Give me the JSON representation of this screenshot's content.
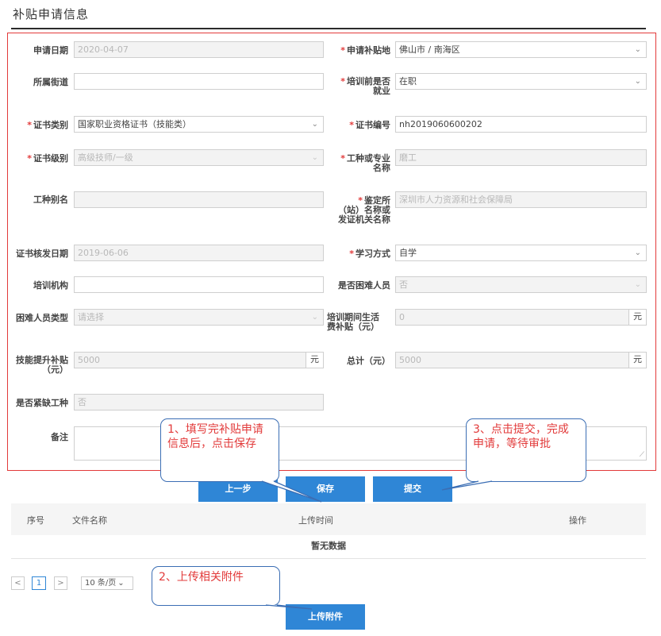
{
  "page_title": "补贴申请信息",
  "form": {
    "apply_date": {
      "label": "申请日期",
      "value": "2020-04-07"
    },
    "apply_place": {
      "label": "申请补贴地",
      "value": "佛山市 / 南海区"
    },
    "street": {
      "label": "所属街道",
      "value": ""
    },
    "employed": {
      "label_1": "培训前是否",
      "label_2": "就业",
      "value": "在职"
    },
    "cert_type": {
      "label": "证书类别",
      "value": "国家职业资格证书（技能类）"
    },
    "cert_no": {
      "label": "证书编号",
      "value": "nh2019060600202"
    },
    "cert_level": {
      "label": "证书级别",
      "value": "高级技师/一级"
    },
    "job_type": {
      "label_1": "工种或专业",
      "label_2": "名称",
      "value": "磨工"
    },
    "job_alias": {
      "label": "工种别名",
      "value": ""
    },
    "issuer": {
      "label_1": "鉴定所",
      "label_2": "（站）名称或",
      "label_3": "发证机关名称",
      "value": "深圳市人力资源和社会保障局"
    },
    "issue_date": {
      "label": "证书核发日期",
      "value": "2019-06-06"
    },
    "study_mode": {
      "label": "学习方式",
      "value": "自学"
    },
    "training_org": {
      "label": "培训机构",
      "value": ""
    },
    "hardship": {
      "label": "是否困难人员",
      "value": "否"
    },
    "hardship_type": {
      "label": "困难人员类型",
      "placeholder": "请选择"
    },
    "living_subsidy": {
      "label_1": "培训期间生活",
      "label_2": "费补贴（元）",
      "value": "0",
      "unit": "元"
    },
    "skill_subsidy": {
      "label_1": "技能提升补贴",
      "label_2": "（元）",
      "value": "5000",
      "unit": "元"
    },
    "total": {
      "label": "总计（元）",
      "value": "5000",
      "unit": "元"
    },
    "shortage": {
      "label": "是否紧缺工种",
      "value": "否"
    },
    "remark": {
      "label": "备注",
      "value": ""
    }
  },
  "buttons": {
    "prev": "上一步",
    "save": "保存",
    "submit": "提交",
    "upload": "上传附件"
  },
  "attachments": {
    "headers": [
      "序号",
      "文件名称",
      "上传时间",
      "操作"
    ],
    "empty_text": "暂无数据"
  },
  "pagination": {
    "prev": "<",
    "page": "1",
    "next": ">",
    "page_size": "10 条/页"
  },
  "callouts": {
    "c1": "1、填写完补贴申请信息后，点击保存",
    "c2": "2、上传相关附件",
    "c3": "3、点击提交，完成申请，等待审批"
  },
  "colors": {
    "required": "#e23a3a",
    "primary": "#2f86d6",
    "callout_border": "#3b6eb4",
    "callout_text": "#e23a3a"
  }
}
